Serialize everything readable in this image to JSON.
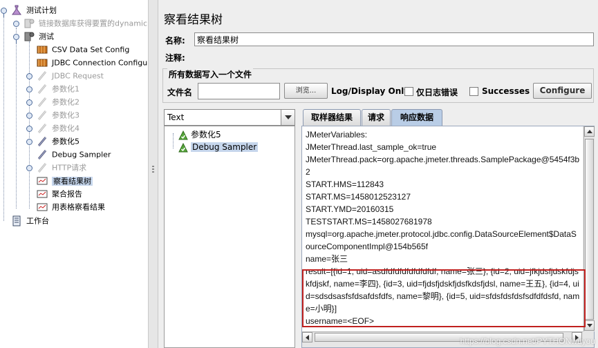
{
  "tree": {
    "nodes": [
      {
        "label": "测试计划",
        "icon": "test-plan-icon",
        "disabled": false,
        "selected": false
      },
      {
        "label": "链接数据库获得要置的dynamic",
        "icon": "config-element-icon",
        "disabled": true,
        "selected": false
      },
      {
        "label": "测试",
        "icon": "thread-group-icon",
        "disabled": false,
        "selected": false
      },
      {
        "label": "CSV Data Set Config",
        "icon": "config-element-icon",
        "disabled": false,
        "selected": false
      },
      {
        "label": "JDBC Connection Configurat",
        "icon": "config-element-icon",
        "disabled": false,
        "selected": false
      },
      {
        "label": "JDBC Request",
        "icon": "sampler-icon",
        "disabled": true,
        "selected": false
      },
      {
        "label": "参数化1",
        "icon": "sampler-icon",
        "disabled": true,
        "selected": false
      },
      {
        "label": "参数化2",
        "icon": "sampler-icon",
        "disabled": true,
        "selected": false
      },
      {
        "label": "参数化3",
        "icon": "sampler-icon",
        "disabled": true,
        "selected": false
      },
      {
        "label": "参数化4",
        "icon": "sampler-icon",
        "disabled": true,
        "selected": false
      },
      {
        "label": "参数化5",
        "icon": "sampler-icon",
        "disabled": false,
        "selected": false
      },
      {
        "label": "Debug Sampler",
        "icon": "sampler-icon",
        "disabled": false,
        "selected": false
      },
      {
        "label": "HTTP请求",
        "icon": "sampler-icon",
        "disabled": true,
        "selected": false
      },
      {
        "label": "察看结果树",
        "icon": "listener-icon",
        "disabled": false,
        "selected": true
      },
      {
        "label": "聚合报告",
        "icon": "listener-icon",
        "disabled": false,
        "selected": false
      },
      {
        "label": "用表格察看结果",
        "icon": "listener-icon",
        "disabled": false,
        "selected": false
      },
      {
        "label": "工作台",
        "icon": "workbench-icon",
        "disabled": false,
        "selected": false
      }
    ]
  },
  "panel": {
    "title": "察看结果树",
    "name_label": "名称:",
    "name_value": "察看结果树",
    "comment_label": "注释:",
    "comment_value": ""
  },
  "file_section": {
    "title": "所有数据写入一个文件",
    "filename_label": "文件名",
    "filename_value": "",
    "browse_label": "浏览...",
    "log_display_label": "Log/Display Only:",
    "errors_only_label": "仅日志错误",
    "errors_only_checked": false,
    "successes_label": "Successes",
    "successes_checked": false,
    "configure_label": "Configure"
  },
  "renderer": {
    "selected": "Text"
  },
  "results": [
    {
      "label": "参数化5",
      "icon": "success-icon",
      "selected": false
    },
    {
      "label": "Debug Sampler",
      "icon": "success-icon",
      "selected": true
    }
  ],
  "tabs": [
    {
      "label": "取样器结果",
      "active": false
    },
    {
      "label": "请求",
      "active": false
    },
    {
      "label": "响应数据",
      "active": true
    }
  ],
  "response_lines": [
    "JMeterVariables:",
    "JMeterThread.last_sample_ok=true",
    "JMeterThread.pack=org.apache.jmeter.threads.SamplePackage@5454f3b2",
    "START.HMS=112843",
    "START.MS=1458012523127",
    "START.YMD=20160315",
    "TESTSTART.MS=1458027681978",
    "mysql=org.apache.jmeter.protocol.jdbc.config.DataSourceElement$DataSourceComponentImpl@154b565f",
    "name=张三",
    "result=[{id=1, uid=asdfdfdfdfdfdfdfdf, name=张三}, {id=2, uid=jfkjdsfjdskfdjskfdjskf, name=李四}, {id=3, uid=fjdsfjdskfjdsfkdsfjdsl, name=王五}, {id=4, uid=sdsdsasfsfdsafdsfdfs, name=黎明}, {id=5, uid=sfdsfdsfdsfsdfdfdsfd, name=小明}]",
    "username=<EOF>"
  ],
  "watermark": "https://blog.csdn.net/PYTHONwuyou",
  "colors": {
    "highlight": "#c0201e",
    "selection": "#c6d6ec",
    "active_tab": "#b9cde6"
  }
}
